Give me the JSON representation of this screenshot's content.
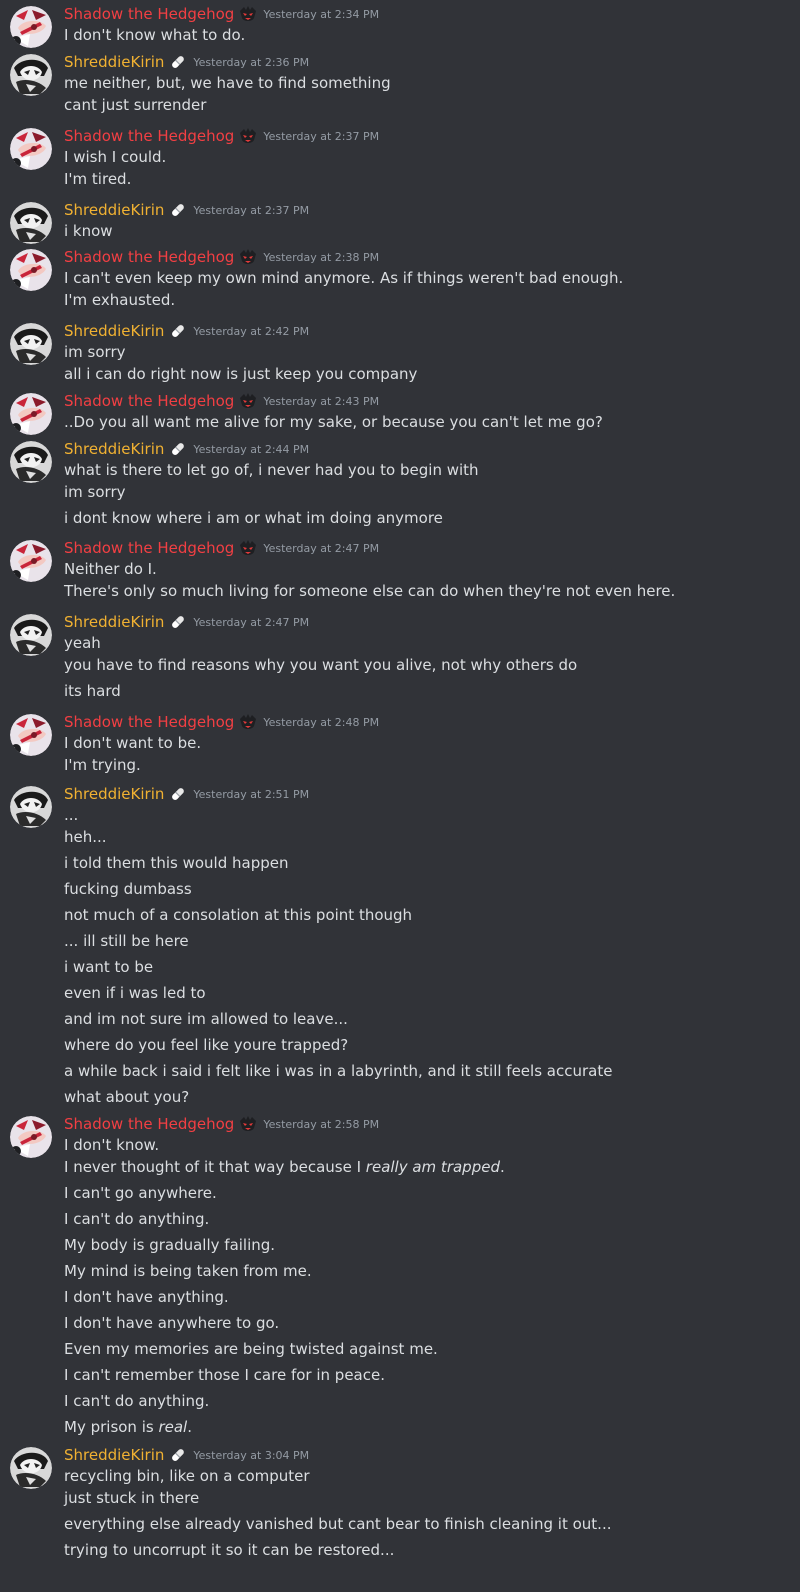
{
  "users": {
    "shadow": {
      "name": "Shadow the Hedgehog",
      "color": "#f23f43",
      "badge_icon": "dark-hedgehog-emoji-icon",
      "avatar_icon": "shadow-avatar-icon"
    },
    "shreddie": {
      "name": "ShreddieKirin",
      "color": "#f0b132",
      "badge_icon": "pill-emoji-icon",
      "avatar_icon": "shreddie-avatar-icon"
    }
  },
  "messages": [
    {
      "user": "shadow",
      "time": "Yesterday at 2:34 PM",
      "lines": [
        "I don't know what to do."
      ]
    },
    {
      "user": "shreddie",
      "time": "Yesterday at 2:36 PM",
      "lines": [
        "me neither, but, we have to find something",
        "cant just surrender"
      ]
    },
    {
      "user": "shadow",
      "time": "Yesterday at 2:37 PM",
      "lines": [
        "I wish I could.",
        "I'm tired."
      ]
    },
    {
      "user": "shreddie",
      "time": "Yesterday at 2:37 PM",
      "lines": [
        "i know"
      ]
    },
    {
      "user": "shadow",
      "time": "Yesterday at 2:38 PM",
      "lines": [
        "I can't even keep my own mind anymore. As if things weren't bad enough.",
        "I'm exhausted."
      ]
    },
    {
      "user": "shreddie",
      "time": "Yesterday at 2:42 PM",
      "lines": [
        "im sorry",
        "all i can do right now is just keep you company"
      ]
    },
    {
      "user": "shadow",
      "time": "Yesterday at 2:43 PM",
      "lines": [
        "..Do you all want me alive for my sake, or because you can't let me go?"
      ]
    },
    {
      "user": "shreddie",
      "time": "Yesterday at 2:44 PM",
      "lines": [
        "what is there to let go of, i never had you to begin with",
        "im sorry",
        "i dont know where i am or what im doing anymore"
      ]
    },
    {
      "user": "shadow",
      "time": "Yesterday at 2:47 PM",
      "lines": [
        "Neither do I.",
        "There's only so much living for someone else can do when they're not even here."
      ]
    },
    {
      "user": "shreddie",
      "time": "Yesterday at 2:47 PM",
      "lines": [
        "yeah",
        "you have to find reasons why you want you alive, not why others do",
        "its hard"
      ]
    },
    {
      "user": "shadow",
      "time": "Yesterday at 2:48 PM",
      "lines": [
        "I don't want to be.",
        "I'm trying."
      ]
    },
    {
      "user": "shreddie",
      "time": "Yesterday at 2:51 PM",
      "lines": [
        "...",
        "heh...",
        "i told them this would happen",
        "fucking dumbass",
        "not much of a consolation at this point though",
        "... ill still be here",
        "i want to be",
        "even if i was led to",
        "and im not sure im allowed to leave...",
        "where do you feel like youre trapped?",
        "a while back i said i felt like i was in a labyrinth, and it still feels accurate",
        "what about you?"
      ]
    },
    {
      "user": "shadow",
      "time": "Yesterday at 2:58 PM",
      "lines": [
        "I don't know.",
        {
          "text": "I never thought of it that way because I ",
          "em": "really am trapped",
          "after": "."
        },
        "I can't go anywhere.",
        "I can't do anything.",
        "My body is gradually failing.",
        "My mind is being taken from me.",
        "I don't have anything.",
        "I don't have anywhere to go.",
        "Even my memories are being twisted against me.",
        "I can't remember those I care for in peace.",
        "I can't do anything.",
        {
          "text": "My prison is ",
          "em": "real",
          "after": "."
        }
      ]
    },
    {
      "user": "shreddie",
      "time": "Yesterday at 3:04 PM",
      "lines": [
        "recycling bin, like on a computer",
        "just stuck in there",
        "everything else already vanished but cant bear to finish cleaning it out...",
        "trying to uncorrupt it so it can be restored..."
      ]
    }
  ]
}
